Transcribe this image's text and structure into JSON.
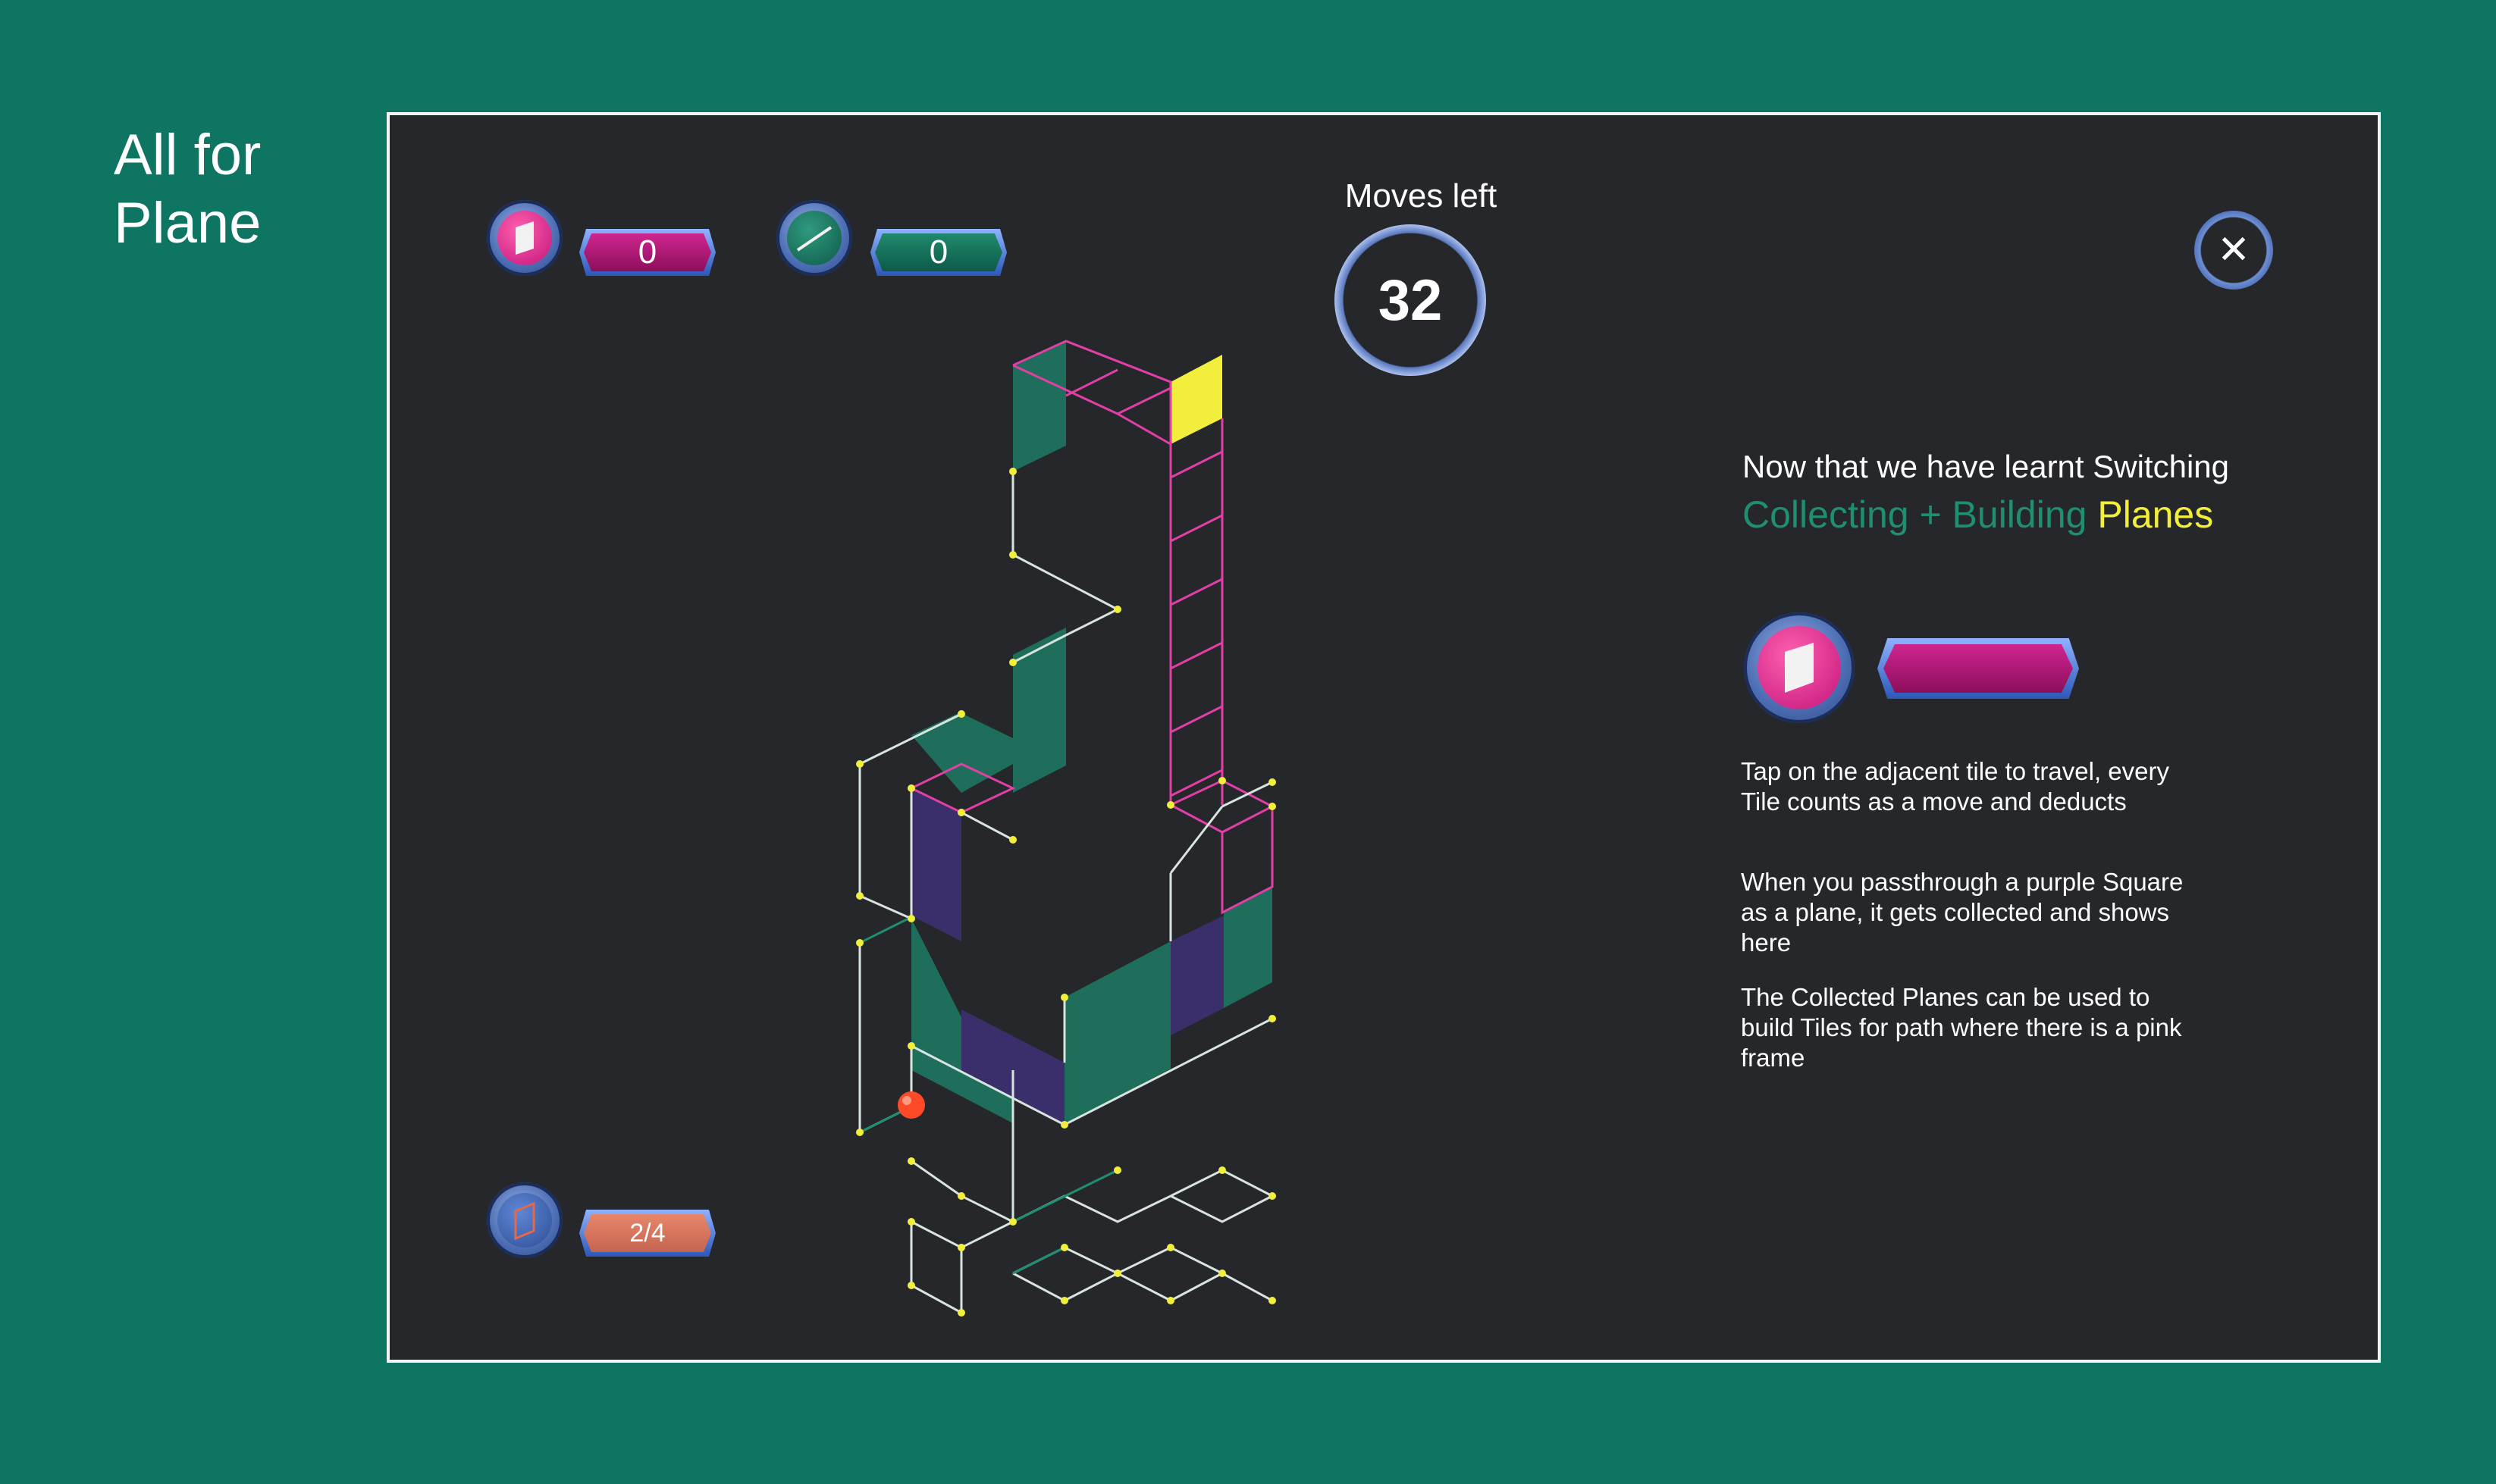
{
  "side_title": "All for Plane",
  "hud": {
    "planes_collected": "0",
    "lines_collected": "0",
    "plane_progress": "2/4",
    "moves_label": "Moves left",
    "moves_value": "32",
    "close_icon": "close-icon"
  },
  "info": {
    "line1": "Now that we have learnt Switching",
    "line2_part1": "Collecting + Building",
    "line2_part2": "Planes",
    "para1": "Tap on the adjacent tile to travel, every Tile counts as a move and deducts",
    "para2": "When you passthrough a purple Square as a plane, it gets collected and shows here",
    "para3": "The Collected Planes can be used to build Tiles for path where there is a pink frame"
  },
  "colors": {
    "background": "#0f7563",
    "board": "#25272a",
    "teal_plane": "#1f6e5c",
    "purple_plane": "#3b2f6b",
    "pink_frame": "#e03fa6",
    "yellow_tile": "#f2ef3c",
    "ball": "#ff4a2a"
  }
}
